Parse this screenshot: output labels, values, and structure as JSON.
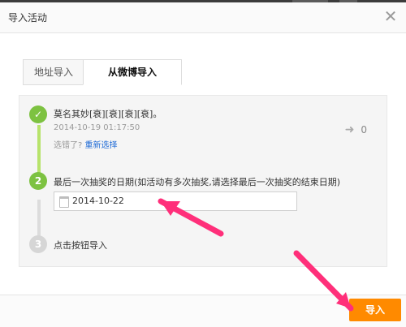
{
  "dialog": {
    "title": "导入活动",
    "close_label": "✕"
  },
  "tabs": [
    {
      "label": "地址导入",
      "active": false
    },
    {
      "label": "从微博导入",
      "active": true
    }
  ],
  "steps": {
    "step1": {
      "number": "✓",
      "post_text": "莫名其妙[衰][衰][衰][衰]。",
      "timestamp": "2014-10-19 01:17:50",
      "wrong_text": "选错了?",
      "reselect_link": "重新选择",
      "share_count": "0"
    },
    "step2": {
      "number": "2",
      "label": "最后一次抽奖的日期(如活动有多次抽奖,请选择最后一次抽奖的结束日期)",
      "date_value": "2014-10-22"
    },
    "step3": {
      "number": "3",
      "label": "点击按钮导入"
    }
  },
  "footer": {
    "import_label": "导入"
  },
  "colors": {
    "accent_green": "#7dc241",
    "accent_orange": "#ff8a00",
    "link_blue": "#1f6bd6",
    "annotation_pink": "#ff2f7a"
  },
  "icons": {
    "check": "check-icon",
    "share": "share-arrow-icon",
    "calendar": "calendar-icon",
    "close": "close-icon"
  }
}
